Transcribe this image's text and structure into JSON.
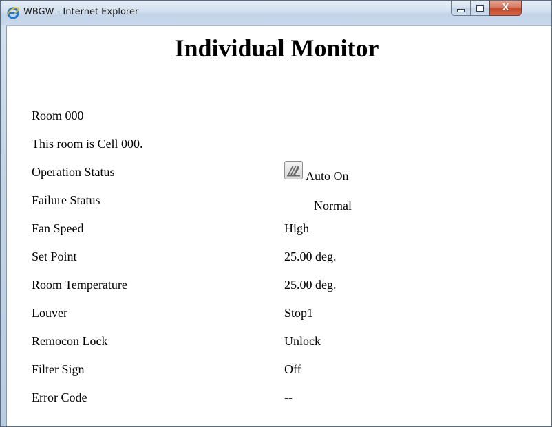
{
  "window": {
    "title": "WBGW - Internet Explorer",
    "icon": "internet-explorer-icon",
    "controls": {
      "minimize_icon": "minimize-icon",
      "maximize_icon": "maximize-icon",
      "close_icon": "close-icon",
      "close_glyph": "X"
    }
  },
  "page": {
    "heading": "Individual Monitor",
    "rows": [
      {
        "label": "Room 000",
        "value": ""
      },
      {
        "label": "This room is Cell 000.",
        "value": ""
      },
      {
        "label": "Operation Status",
        "value": "Auto On",
        "icon": "auto-mode-icon"
      },
      {
        "label": "Failure Status",
        "value": "Normal"
      },
      {
        "label": "Fan Speed",
        "value": "High"
      },
      {
        "label": "Set Point",
        "value": "25.00 deg."
      },
      {
        "label": "Room Temperature",
        "value": "25.00 deg."
      },
      {
        "label": "Louver",
        "value": "Stop1"
      },
      {
        "label": "Remocon Lock",
        "value": "Unlock"
      },
      {
        "label": "Filter Sign",
        "value": "Off"
      },
      {
        "label": "Error Code",
        "value": "--"
      }
    ]
  },
  "colors": {
    "close_button": "#c4492b",
    "page_background": "#ffffff",
    "text": "#000000"
  }
}
